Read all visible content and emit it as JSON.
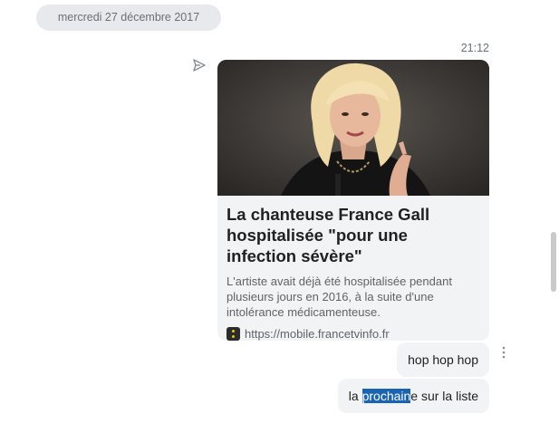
{
  "conversation": {
    "date_chip": "mercredi 27 décembre 2017",
    "time": "21:12"
  },
  "link_preview": {
    "title": "La chanteuse France Gall hospitalisée \"pour une infection sévère\"",
    "description": "L'artiste avait déjà été hospitalisée pendant plusieurs jours en 2016, à la suite d'une intolérance médicamenteuse.",
    "url": "https://mobile.francetvinfo.fr",
    "favicon": "francetvinfo-favicon"
  },
  "messages": [
    {
      "text": "hop hop hop"
    },
    {
      "before": "la ",
      "highlight": "prochain",
      "after": "e sur la liste"
    }
  ],
  "icons": {
    "sent": "sent-arrow-icon",
    "more": "more-vertical-icon"
  },
  "colors": {
    "bubble": "#f1f3f4",
    "selection": "#1a64b3",
    "date_chip": "#e8e9ec"
  }
}
